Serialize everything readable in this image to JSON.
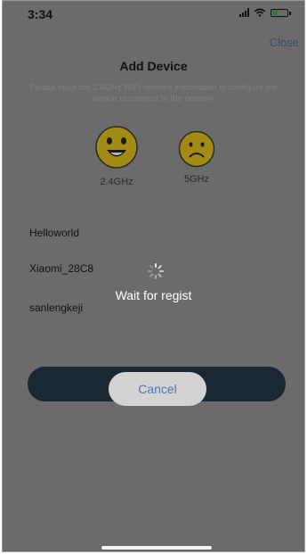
{
  "status_bar": {
    "time": "3:34"
  },
  "header": {
    "close_label": "Close",
    "title": "Add Device"
  },
  "instructions": "Please input the 2.4GHz WiFi network information to configure the device to connect to the network",
  "bands": [
    {
      "label": "2.4GHz",
      "icon": "smiley-face-icon"
    },
    {
      "label": "5GHz",
      "icon": "sad-face-icon"
    }
  ],
  "networks": [
    "Helloworld",
    "Xiaomi_28C8",
    "sanlengkeji"
  ],
  "overlay": {
    "message": "Wait for regist",
    "cancel_label": "Cancel"
  },
  "colors": {
    "face_yellow": "#a38a12",
    "link_blue": "#4a7ab5",
    "dim_background": "#6b6b6b"
  }
}
